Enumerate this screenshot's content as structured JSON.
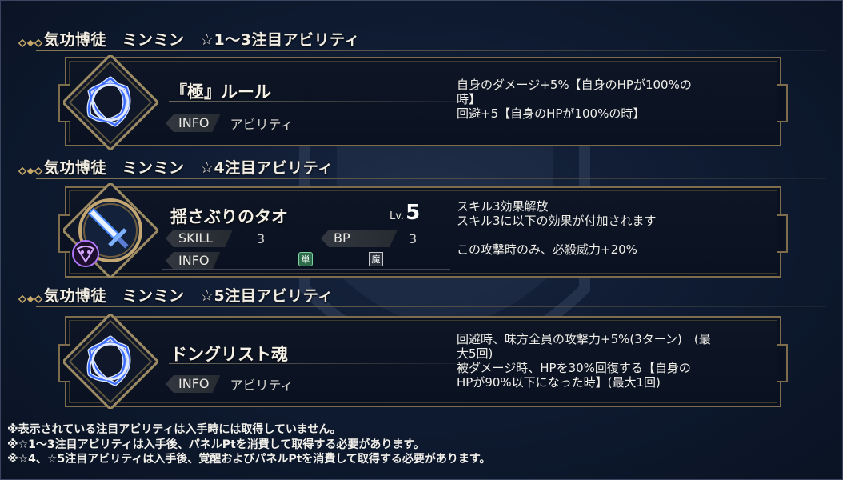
{
  "sections": [
    {
      "title": "気功博徒　ミンミン　☆1～3注目アビリティ",
      "ability": {
        "name": "『極』ルール",
        "tag_label": "INFO",
        "tag_value": "アビリティ",
        "desc": [
          "自身のダメージ+5%【自身のHPが100%の",
          "時】",
          "回避+5【自身のHPが100%の時】"
        ],
        "icon": "celtic-knot-icon"
      }
    },
    {
      "title": "気功博徒　ミンミン　☆4注目アビリティ",
      "skill": {
        "name": "揺さぶりのタオ",
        "level_prefix": "Lv.",
        "level": "5",
        "skill_label": "SKILL",
        "skill_value": "3",
        "bp_label": "BP",
        "bp_value": "3",
        "info_label": "INFO",
        "target_badge": "単",
        "element_badge": "魔",
        "desc": [
          "スキル3効果解放",
          "スキル3に以下の効果が付加されます",
          "",
          "この攻撃時のみ、必殺威力+20%"
        ],
        "icon": "sword-icon",
        "sub_icon": "demon-mask-icon"
      }
    },
    {
      "title": "気功博徒　ミンミン　☆5注目アビリティ",
      "ability": {
        "name": "ドングリスト魂",
        "tag_label": "INFO",
        "tag_value": "アビリティ",
        "desc": [
          "回避時、味方全員の攻撃力+5%(3ターン)　(最",
          "大5回)",
          "被ダメージ時、HPを30%回復する【自身の",
          "HPが90%以下になった時】(最大1回)"
        ],
        "icon": "celtic-knot-icon"
      }
    }
  ],
  "notes": [
    "※表示されている注目アビリティは入手時には取得していません。",
    "※☆1～3注目アビリティは入手後、パネルPtを消費して取得する必要があります。",
    "※☆4、☆5注目アビリティは入手後、覚醒およびパネルPtを消費して取得する必要があります。"
  ],
  "colors": {
    "background": "#0e1a30",
    "frame_gold": "#7d6d4c",
    "icon_blue": "#3c6cff"
  }
}
